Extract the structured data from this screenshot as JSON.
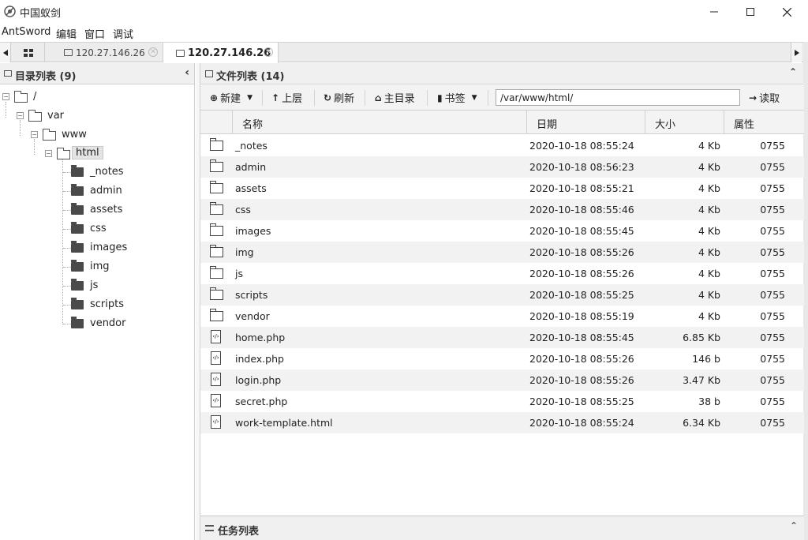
{
  "window": {
    "title": "中国蚁剑"
  },
  "menu": [
    "AntSword",
    "编辑",
    "窗口",
    "调试"
  ],
  "tabs": {
    "tab1": "120.27.146.26",
    "tab2": "120.27.146.26"
  },
  "left": {
    "header": "目录列表 (9)",
    "tree": {
      "root": "/",
      "var": "var",
      "www": "www",
      "html": "html",
      "children": [
        "_notes",
        "admin",
        "assets",
        "css",
        "images",
        "img",
        "js",
        "scripts",
        "vendor"
      ]
    }
  },
  "right": {
    "header": "文件列表 (14)",
    "toolbar": {
      "new": "新建",
      "up": "上层",
      "refresh": "刷新",
      "home": "主目录",
      "bookmark": "书签",
      "path": "/var/www/html/",
      "read": "读取"
    },
    "columns": {
      "name": "名称",
      "date": "日期",
      "size": "大小",
      "attr": "属性"
    },
    "files": [
      {
        "name": "_notes",
        "date": "2020-10-18 08:55:24",
        "size": "4 Kb",
        "attr": "0755",
        "type": "folder"
      },
      {
        "name": "admin",
        "date": "2020-10-18 08:56:23",
        "size": "4 Kb",
        "attr": "0755",
        "type": "folder"
      },
      {
        "name": "assets",
        "date": "2020-10-18 08:55:21",
        "size": "4 Kb",
        "attr": "0755",
        "type": "folder"
      },
      {
        "name": "css",
        "date": "2020-10-18 08:55:46",
        "size": "4 Kb",
        "attr": "0755",
        "type": "folder"
      },
      {
        "name": "images",
        "date": "2020-10-18 08:55:45",
        "size": "4 Kb",
        "attr": "0755",
        "type": "folder"
      },
      {
        "name": "img",
        "date": "2020-10-18 08:55:26",
        "size": "4 Kb",
        "attr": "0755",
        "type": "folder"
      },
      {
        "name": "js",
        "date": "2020-10-18 08:55:26",
        "size": "4 Kb",
        "attr": "0755",
        "type": "folder"
      },
      {
        "name": "scripts",
        "date": "2020-10-18 08:55:25",
        "size": "4 Kb",
        "attr": "0755",
        "type": "folder"
      },
      {
        "name": "vendor",
        "date": "2020-10-18 08:55:19",
        "size": "4 Kb",
        "attr": "0755",
        "type": "folder"
      },
      {
        "name": "home.php",
        "date": "2020-10-18 08:55:45",
        "size": "6.85 Kb",
        "attr": "0755",
        "type": "file"
      },
      {
        "name": "index.php",
        "date": "2020-10-18 08:55:26",
        "size": "146 b",
        "attr": "0755",
        "type": "file"
      },
      {
        "name": "login.php",
        "date": "2020-10-18 08:55:26",
        "size": "3.47 Kb",
        "attr": "0755",
        "type": "file"
      },
      {
        "name": "secret.php",
        "date": "2020-10-18 08:55:25",
        "size": "38 b",
        "attr": "0755",
        "type": "file"
      },
      {
        "name": "work-template.html",
        "date": "2020-10-18 08:55:24",
        "size": "6.34 Kb",
        "attr": "0755",
        "type": "file"
      }
    ],
    "task_header": "任务列表"
  }
}
